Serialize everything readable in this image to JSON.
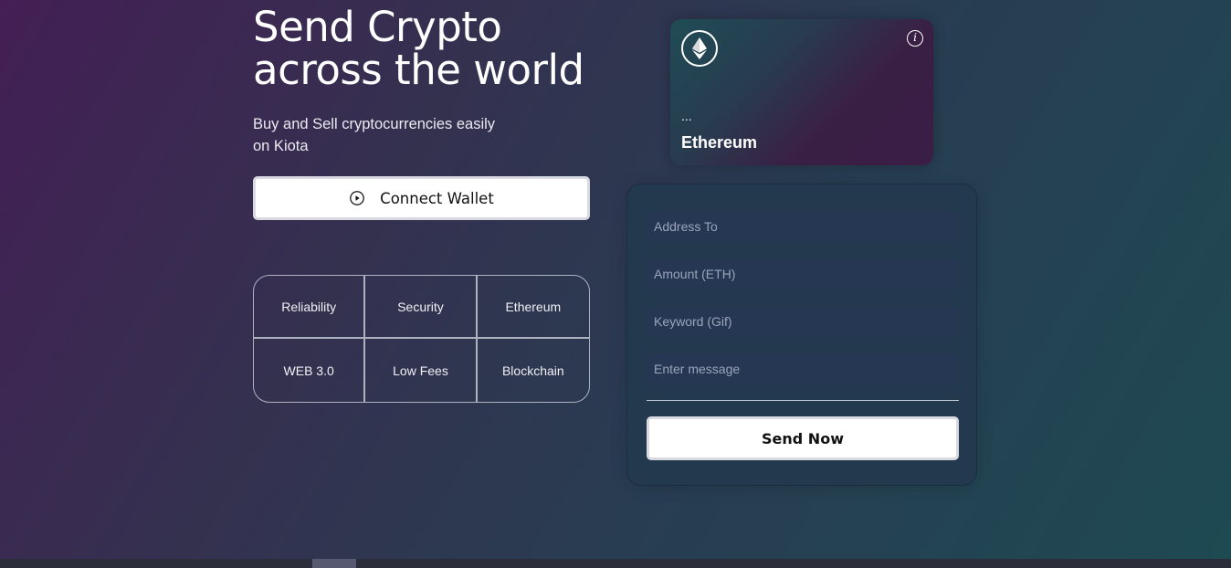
{
  "hero": {
    "title_line1": "Send Crypto",
    "title_line2": "across the world",
    "subtitle_line1": "Buy and Sell cryptocurrencies easily",
    "subtitle_line2": "on Kiota",
    "connect_label": "Connect Wallet",
    "connect_icon": "play-circle-icon"
  },
  "features": [
    "Reliability",
    "Security",
    "Ethereum",
    "WEB 3.0",
    "Low Fees",
    "Blockchain"
  ],
  "eth_card": {
    "logo_icon": "ethereum-icon",
    "info_icon": "info-icon",
    "info_glyph": "i",
    "address": "...",
    "name": "Ethereum"
  },
  "form": {
    "address_placeholder": "Address To",
    "amount_placeholder": "Amount (ETH)",
    "keyword_placeholder": "Keyword (Gif)",
    "message_placeholder": "Enter message",
    "send_label": "Send Now"
  },
  "colors": {
    "bg_start": "#431f55",
    "bg_end": "#1e4a52",
    "form_bg": "#22394e",
    "field_bg": "#263754"
  }
}
